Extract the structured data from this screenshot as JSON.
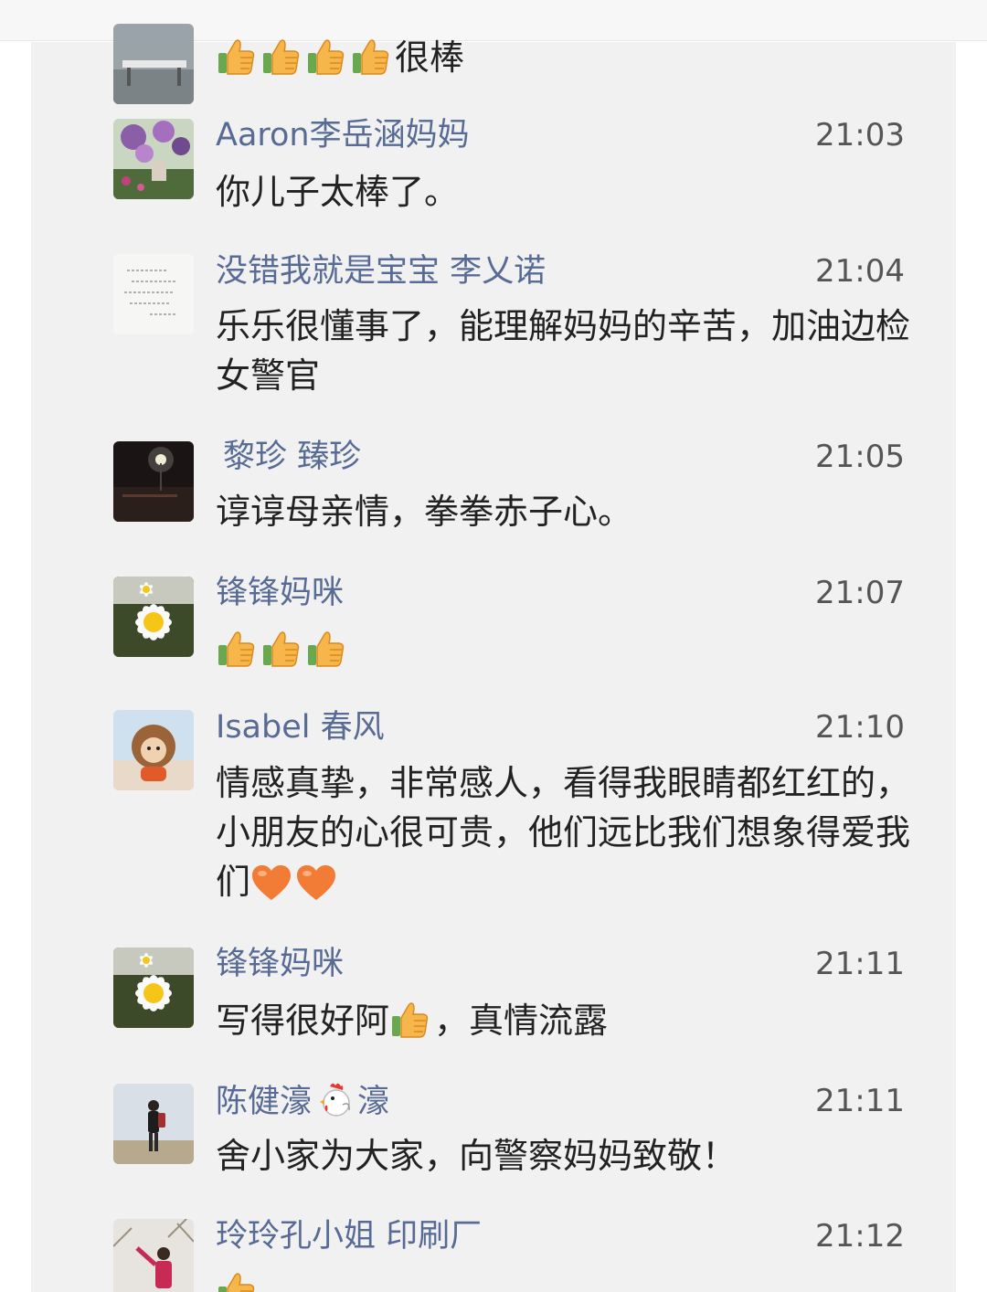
{
  "comments": [
    {
      "name": "",
      "time": "",
      "parts": [
        {
          "emoji": "thumbs-up"
        },
        {
          "emoji": "thumbs-up"
        },
        {
          "emoji": "thumbs-up"
        },
        {
          "emoji": "thumbs-up"
        },
        {
          "text": "很棒"
        }
      ]
    },
    {
      "name": "Aaron李岳涵妈妈",
      "time": "21:03",
      "parts": [
        {
          "text": "你儿子太棒了。"
        }
      ]
    },
    {
      "name": "没错我就是宝宝 李乂诺",
      "time": "21:04",
      "parts": [
        {
          "text": "乐乐很懂事了，能理解妈妈的辛苦，加油边检女警官"
        }
      ]
    },
    {
      "name": "黎珍 臻珍",
      "time": "21:05",
      "parts": [
        {
          "text": "谆谆母亲情，拳拳赤子心。"
        }
      ]
    },
    {
      "name": "锋锋妈咪",
      "time": "21:07",
      "parts": [
        {
          "emoji": "thumbs-up"
        },
        {
          "emoji": "thumbs-up"
        },
        {
          "emoji": "thumbs-up"
        }
      ]
    },
    {
      "name": "Isabel 春风",
      "time": "21:10",
      "parts": [
        {
          "text": "情感真挚，非常感人，看得我眼睛都红红的，小朋友的心很可贵，他们远比我们想象得爱我们"
        },
        {
          "emoji": "orange-heart"
        },
        {
          "emoji": "orange-heart"
        }
      ]
    },
    {
      "name": "锋锋妈咪",
      "time": "21:11",
      "parts": [
        {
          "text": "写得很好阿"
        },
        {
          "emoji": "thumbs-up"
        },
        {
          "text": "，真情流露"
        }
      ]
    },
    {
      "name": "陈健濠",
      "name_emoji": "rooster",
      "name_suffix": "濠",
      "time": "21:11",
      "parts": [
        {
          "text": "舍小家为大家，向警察妈妈致敬！"
        }
      ]
    },
    {
      "name": "玲玲孔小姐 印刷厂",
      "time": "21:12",
      "parts": [
        {
          "emoji": "thumbs-up"
        }
      ]
    }
  ],
  "avatars": [
    "bench-photo-avatar",
    "flower-pot-avatar",
    "handwritten-note-avatar",
    "night-street-avatar",
    "daisy-avatar",
    "plush-doll-avatar",
    "daisy-avatar",
    "man-outdoors-avatar",
    "woman-outdoors-avatar"
  ],
  "colors": {
    "name": "#576b95",
    "text": "#222222",
    "time": "#555555",
    "panel": "#f1f1f2"
  }
}
